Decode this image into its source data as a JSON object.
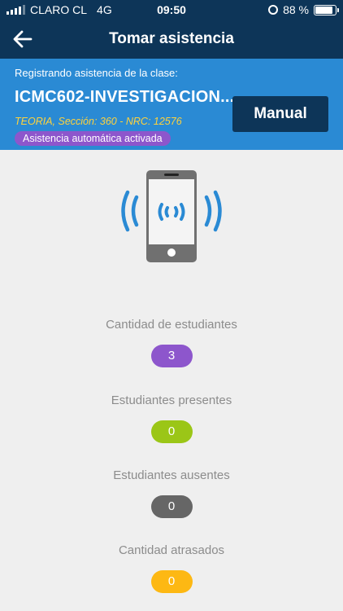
{
  "status_bar": {
    "carrier": "CLARO CL",
    "network": "4G",
    "time": "09:50",
    "battery": "88 %"
  },
  "app_bar": {
    "title": "Tomar asistencia",
    "back_icon": "arrow-left-icon"
  },
  "class_panel": {
    "label": "Registrando asistencia de la clase:",
    "code": "ICMC602-INVESTIGACION...",
    "meta": "TEORIA, Sección: 360 - NRC: 12576",
    "auto_badge": "Asistencia automática activada",
    "manual_button": "Manual"
  },
  "illustration": {
    "icon": "phone-broadcast-icon"
  },
  "stats": [
    {
      "label": "Cantidad de estudiantes",
      "value": "3",
      "color": "#8d56cc"
    },
    {
      "label": "Estudiantes presentes",
      "value": "0",
      "color": "#9bc617"
    },
    {
      "label": "Estudiantes ausentes",
      "value": "0",
      "color": "#666666"
    },
    {
      "label": "Cantidad atrasados",
      "value": "0",
      "color": "#fdb813"
    }
  ],
  "colors": {
    "header": "#0d3558",
    "panel": "#2a8ad4",
    "background": "#efefef",
    "accent_yellow": "#ffd23c"
  }
}
